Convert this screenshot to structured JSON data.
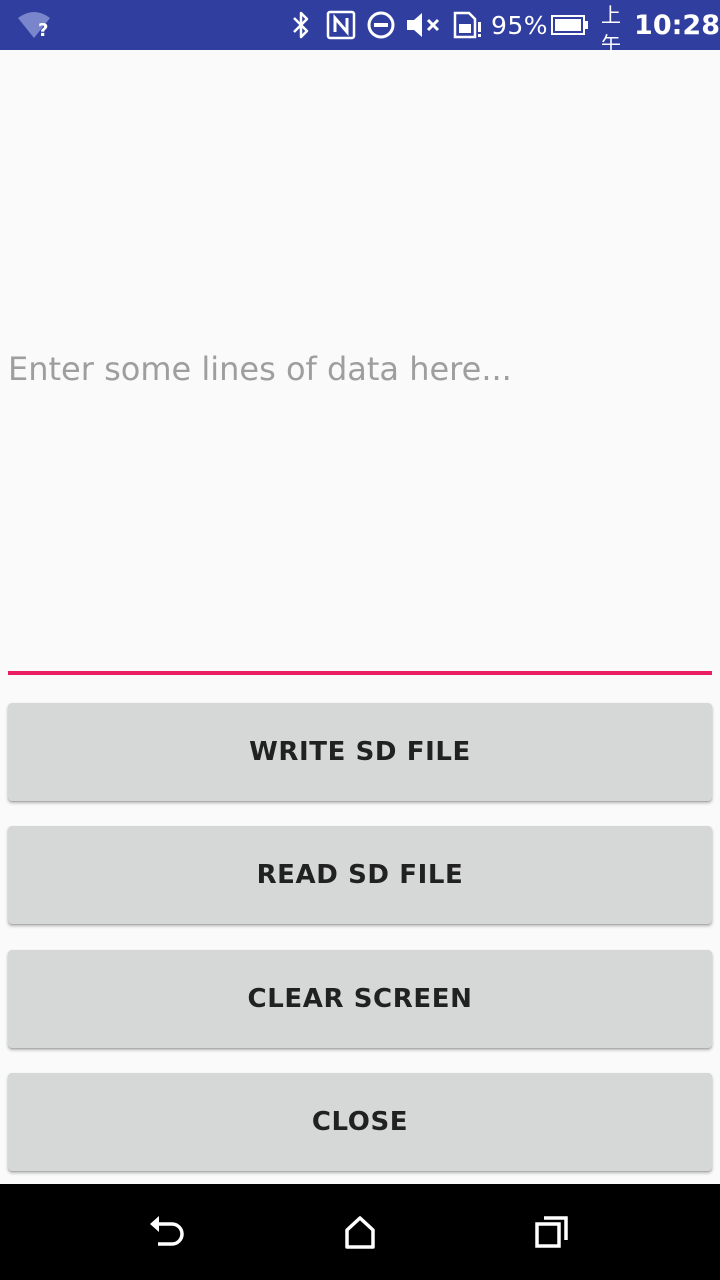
{
  "status_bar": {
    "battery_percent": "95%",
    "clock_prefix": "上午",
    "clock_time": "10:28",
    "icons": [
      "wifi-unknown-icon",
      "bluetooth-icon",
      "nfc-icon",
      "do-not-disturb-icon",
      "volume-muted-icon",
      "sd-card-alert-icon",
      "battery-icon"
    ],
    "background_color": "#303f9f"
  },
  "main": {
    "input": {
      "placeholder": "Enter some lines of data here...",
      "value": "",
      "underline_color": "#e91e63"
    },
    "buttons": {
      "write": "WRITE SD FILE",
      "read": "READ SD FILE",
      "clear": "CLEAR SCREEN",
      "close": "CLOSE"
    }
  },
  "nav_bar": {
    "icons": [
      "back-icon",
      "home-icon",
      "recents-icon"
    ]
  }
}
